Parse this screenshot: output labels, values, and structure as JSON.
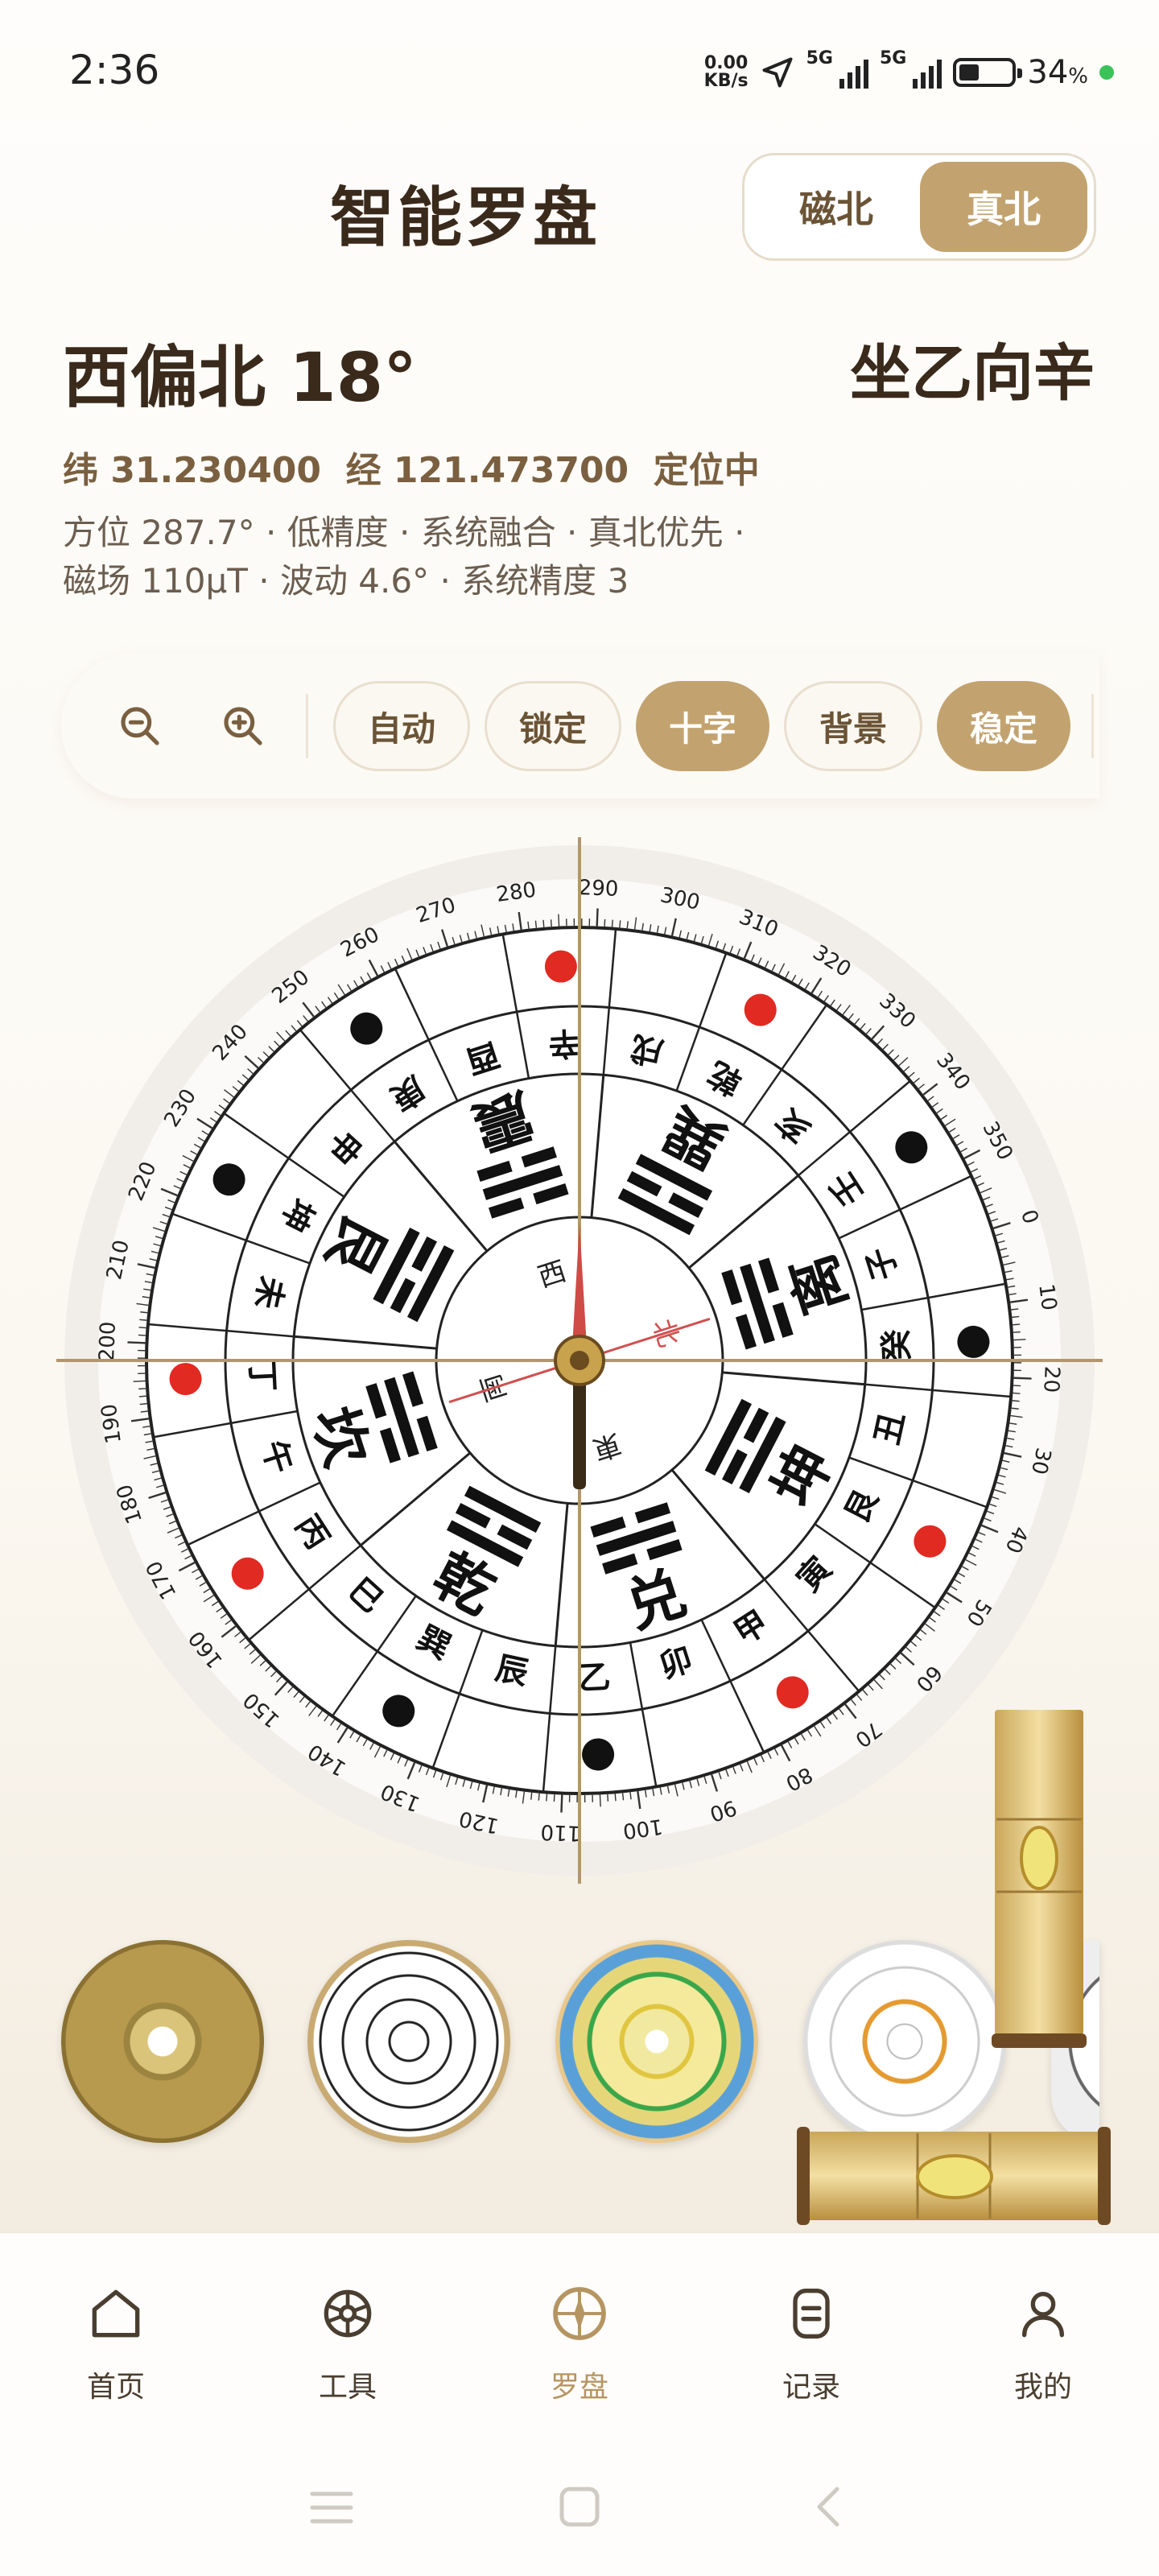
{
  "status_bar": {
    "time": "2:36",
    "net_speed_value": "0.00",
    "net_speed_unit": "KB/s",
    "network_1": "5G",
    "network_2": "5G",
    "battery": "34",
    "battery_unit": "%"
  },
  "header": {
    "title": "智能罗盘",
    "toggle": {
      "magnetic_label": "磁北",
      "true_label": "真北",
      "selected": "真北"
    }
  },
  "reading": {
    "direction": "西偏北 18°",
    "sitting": "坐乙向辛",
    "coords": "纬 31.230400  经 121.473700  定位中",
    "info_line1": "方位 287.7° · 低精度 · 系统融合 · 真北优先 ·",
    "info_line2": "磁场 110μT · 波动 4.6° · 系统精度 3"
  },
  "toolbar": {
    "zoom_out_icon": "zoom-out-icon",
    "zoom_in_icon": "zoom-in-icon",
    "chips": [
      {
        "label": "自动",
        "active": false
      },
      {
        "label": "锁定",
        "active": false
      },
      {
        "label": "十字",
        "active": true
      },
      {
        "label": "背景",
        "active": false
      },
      {
        "label": "稳定",
        "active": true
      }
    ]
  },
  "compass": {
    "heading_deg": 287.7,
    "needle_labels": {
      "north": "北",
      "south": "南",
      "east": "東",
      "west": "西"
    },
    "degree_labels": [
      "0",
      "10",
      "20",
      "30",
      "40",
      "50",
      "60",
      "70",
      "80",
      "90",
      "100",
      "110",
      "120",
      "130",
      "140",
      "150",
      "160",
      "170",
      "180",
      "190",
      "200",
      "210",
      "220",
      "230",
      "240",
      "250",
      "260",
      "270",
      "280",
      "290",
      "300",
      "310",
      "320",
      "330",
      "340",
      "350"
    ],
    "trigrams": [
      "坎",
      "艮",
      "震",
      "巽",
      "离",
      "坤",
      "兑",
      "乾"
    ],
    "mountains": [
      "子",
      "癸",
      "丑",
      "艮",
      "寅",
      "甲",
      "卯",
      "乙",
      "辰",
      "巽",
      "巳",
      "丙",
      "午",
      "丁",
      "未",
      "坤",
      "申",
      "庚",
      "酉",
      "辛",
      "戌",
      "乾",
      "亥",
      "壬"
    ],
    "dots": [
      "black",
      "red",
      "red",
      "black",
      "black",
      "red",
      "red",
      "black",
      "black",
      "red",
      "red",
      "black"
    ],
    "colors": {
      "needle_red": "#cf4b46",
      "needle_dark": "#3a2a18",
      "cross": "#b29670",
      "dot_red": "#e02a22",
      "dot_black": "#111111"
    }
  },
  "thumbnails": [
    "bronze-luopan",
    "classic-luopan",
    "colorful-luopan",
    "grey-luopan",
    "partial-luopan"
  ],
  "nav": {
    "items": [
      {
        "label": "首页",
        "icon": "home-icon",
        "active": false
      },
      {
        "label": "工具",
        "icon": "tools-icon",
        "active": false
      },
      {
        "label": "罗盘",
        "icon": "compass-icon",
        "active": true
      },
      {
        "label": "记录",
        "icon": "records-icon",
        "active": false
      },
      {
        "label": "我的",
        "icon": "profile-icon",
        "active": false
      }
    ]
  },
  "accent": "#c2a36f"
}
